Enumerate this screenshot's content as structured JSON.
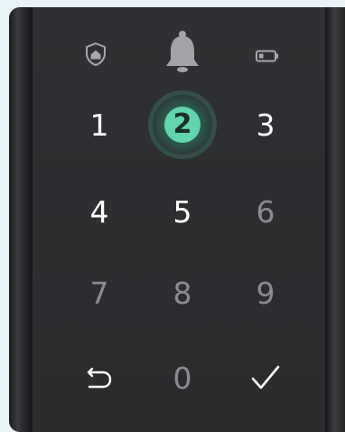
{
  "header": {
    "home_icon": "home-shield-icon",
    "bell_icon": "doorbell-icon",
    "battery_icon": "battery-low-icon"
  },
  "keypad": {
    "k1": "1",
    "k2": "2",
    "k3": "3",
    "k4": "4",
    "k5": "5",
    "k6": "6",
    "k7": "7",
    "k8": "8",
    "k9": "9",
    "k0": "0",
    "back_icon": "return-arrow-icon",
    "confirm_icon": "checkmark-icon",
    "active_key": "2"
  },
  "colors": {
    "panel": "#2b2c2e",
    "active_glow": "#5fd6ad",
    "bright_digit": "#ffffff",
    "dim_digit": "#8b8c8f"
  }
}
